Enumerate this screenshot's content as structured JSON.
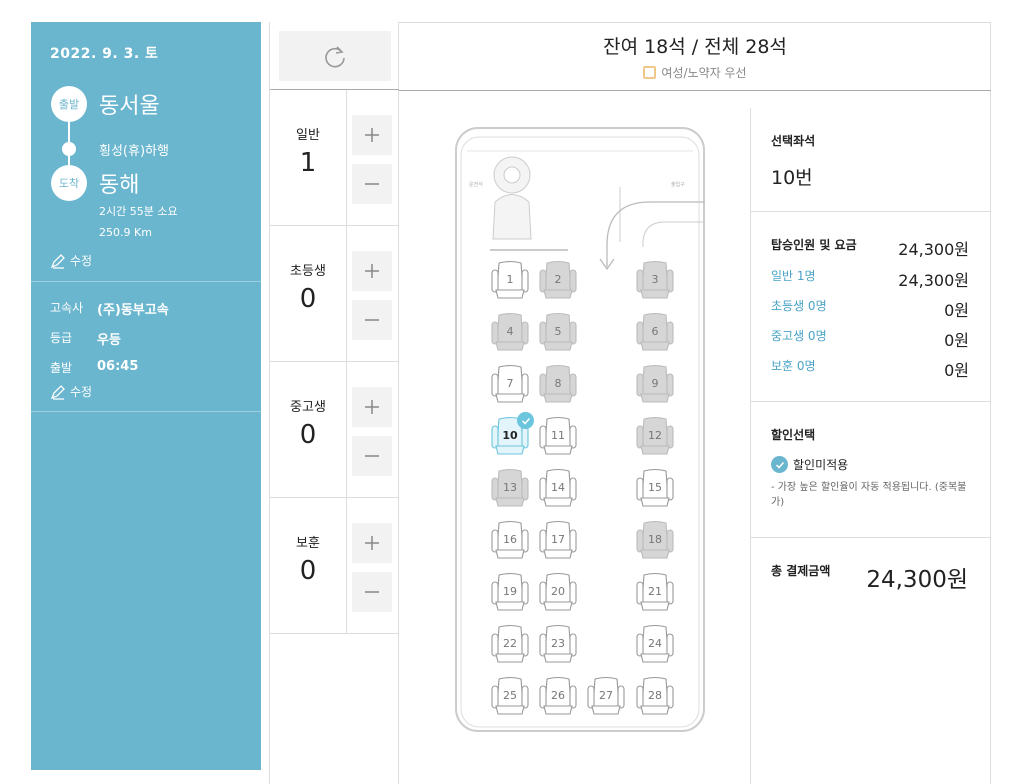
{
  "sidebar": {
    "date": "2022. 9. 3. 토",
    "depart_badge": "출발",
    "depart_city": "동서울",
    "via": "횡성(휴)하행",
    "arrive_badge": "도착",
    "arrive_city": "동해",
    "duration": "2시간 55분 소요",
    "distance": "250.9 Km",
    "edit_label": "수정",
    "company_label": "고속사",
    "company": "(주)동부고속",
    "grade_label": "등급",
    "grade": "우등",
    "time_label": "출발",
    "time": "06:45",
    "edit2_label": "수정"
  },
  "passengers": [
    {
      "label": "일반",
      "count": "1"
    },
    {
      "label": "초등생",
      "count": "0"
    },
    {
      "label": "중고생",
      "count": "0"
    },
    {
      "label": "보훈",
      "count": "0"
    }
  ],
  "header": {
    "title": "잔여 18석 / 전체 28석",
    "legend": "여성/노약자 우선"
  },
  "bus": {
    "driver_label": "운전석",
    "door_label": "출입구",
    "seats": [
      {
        "n": "1",
        "available": true
      },
      {
        "n": "2",
        "available": false
      },
      {
        "n": "3",
        "available": false
      },
      {
        "n": "4",
        "available": false
      },
      {
        "n": "5",
        "available": false
      },
      {
        "n": "6",
        "available": false
      },
      {
        "n": "7",
        "available": true
      },
      {
        "n": "8",
        "available": false
      },
      {
        "n": "9",
        "available": false
      },
      {
        "n": "10",
        "available": true,
        "selected": true
      },
      {
        "n": "11",
        "available": true
      },
      {
        "n": "12",
        "available": false
      },
      {
        "n": "13",
        "available": false
      },
      {
        "n": "14",
        "available": true
      },
      {
        "n": "15",
        "available": true
      },
      {
        "n": "16",
        "available": true
      },
      {
        "n": "17",
        "available": true
      },
      {
        "n": "18",
        "available": false
      },
      {
        "n": "19",
        "available": true
      },
      {
        "n": "20",
        "available": true
      },
      {
        "n": "21",
        "available": true
      },
      {
        "n": "22",
        "available": true
      },
      {
        "n": "23",
        "available": true
      },
      {
        "n": "24",
        "available": true
      },
      {
        "n": "25",
        "available": true
      },
      {
        "n": "26",
        "available": true
      },
      {
        "n": "27",
        "available": true
      },
      {
        "n": "28",
        "available": true
      }
    ]
  },
  "summary": {
    "selected_title": "선택좌석",
    "selected_value": "10번",
    "fare_title": "탑승인원 및 요금",
    "fare_total": "24,300원",
    "rows": [
      {
        "label": "일반 1명",
        "amount": "24,300원"
      },
      {
        "label": "초등생 0명",
        "amount": "0원"
      },
      {
        "label": "중고생 0명",
        "amount": "0원"
      },
      {
        "label": "보훈 0명",
        "amount": "0원"
      }
    ],
    "discount_title": "할인선택",
    "discount_option": "할인미적용",
    "discount_note": "- 가장 높은 할인율이 자동 적용됩니다. (중복불가)",
    "total_title": "총 결제금액",
    "total_amount": "24,300원"
  },
  "colors": {
    "accent": "#6bb6cf",
    "seat_selected": "#6bc5dd",
    "seat_unavailable": "#d6d6d6"
  }
}
